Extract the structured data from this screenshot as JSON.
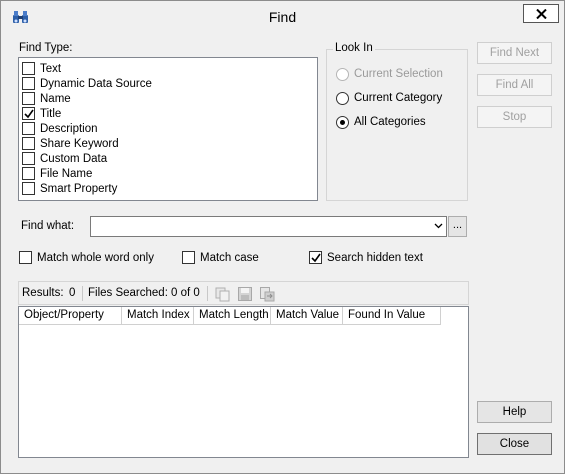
{
  "window": {
    "title": "Find"
  },
  "find_type": {
    "label": "Find Type:",
    "items": [
      {
        "label": "Text",
        "checked": false
      },
      {
        "label": "Dynamic Data Source",
        "checked": false
      },
      {
        "label": "Name",
        "checked": false
      },
      {
        "label": "Title",
        "checked": true
      },
      {
        "label": "Description",
        "checked": false
      },
      {
        "label": "Share Keyword",
        "checked": false
      },
      {
        "label": "Custom Data",
        "checked": false
      },
      {
        "label": "File Name",
        "checked": false
      },
      {
        "label": "Smart Property",
        "checked": false
      }
    ]
  },
  "look_in": {
    "label": "Look In",
    "options": [
      {
        "label": "Current Selection",
        "selected": false,
        "enabled": false
      },
      {
        "label": "Current Category",
        "selected": false,
        "enabled": true
      },
      {
        "label": "All Categories",
        "selected": true,
        "enabled": true
      }
    ]
  },
  "buttons": {
    "find_next": "Find Next",
    "find_all": "Find All",
    "stop": "Stop",
    "help": "Help",
    "close": "Close"
  },
  "find_what": {
    "label": "Find what:",
    "value": "",
    "browse_label": "..."
  },
  "options": {
    "match_whole_word": {
      "label": "Match whole word only",
      "checked": false
    },
    "match_case": {
      "label": "Match case",
      "checked": false
    },
    "search_hidden": {
      "label": "Search hidden text",
      "checked": true
    }
  },
  "results": {
    "results_label": "Results:",
    "results_count": "0",
    "files_label": "Files Searched:",
    "files_value": "0 of 0"
  },
  "grid": {
    "columns": [
      "Object/Property",
      "Match Index",
      "Match Length",
      "Match Value",
      "Found In Value"
    ]
  }
}
